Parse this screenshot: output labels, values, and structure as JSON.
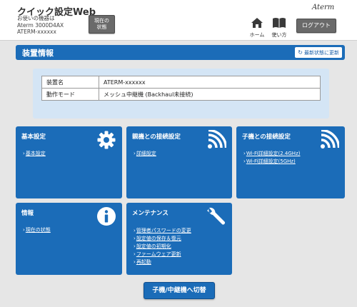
{
  "header": {
    "app_title": "クイック設定Web",
    "device_info": [
      "お使いの機器は",
      "Aterm 3000D4AX",
      "ATERM-xxxxxx"
    ],
    "status_button": [
      "現在の",
      "状態"
    ],
    "brand": "Aterm",
    "home_label": "ホーム",
    "help_label": "使い方",
    "logout_label": "ログアウト"
  },
  "device_section": {
    "title": "装置情報",
    "refresh_label": "最新状態に更新",
    "rows": [
      {
        "key": "装置名",
        "value": "ATERM-xxxxxx"
      },
      {
        "key": "動作モード",
        "value": "メッシュ中継機 (Backhaul未接続)"
      }
    ]
  },
  "cards": {
    "basic": {
      "title": "基本設定",
      "icon": "gear-icon",
      "links": [
        "基本設定"
      ]
    },
    "parent": {
      "title": "親機との接続設定",
      "icon": "wifi-icon",
      "links": [
        "詳細設定"
      ]
    },
    "child": {
      "title": "子機との接続設定",
      "icon": "wifi-icon",
      "links": [
        "Wi-Fi詳細設定(2.4GHz)",
        "Wi-Fi詳細設定(5GHz)"
      ]
    },
    "info": {
      "title": "情報",
      "icon": "info-icon",
      "links": [
        "現在の状態"
      ]
    },
    "maintenance": {
      "title": "メンテナンス",
      "icon": "wrench-icon",
      "links": [
        "管理者パスワードの変更",
        "設定値の保存＆復元",
        "設定値の初期化",
        "ファームウェア更新",
        "再起動"
      ]
    }
  },
  "switch_button": "子機/中継機へ切替",
  "colors": {
    "accent": "#1b6cb8",
    "panel": "#d4e5f5",
    "background": "#e6e6e6",
    "button_gray": "#6a6a6a"
  }
}
